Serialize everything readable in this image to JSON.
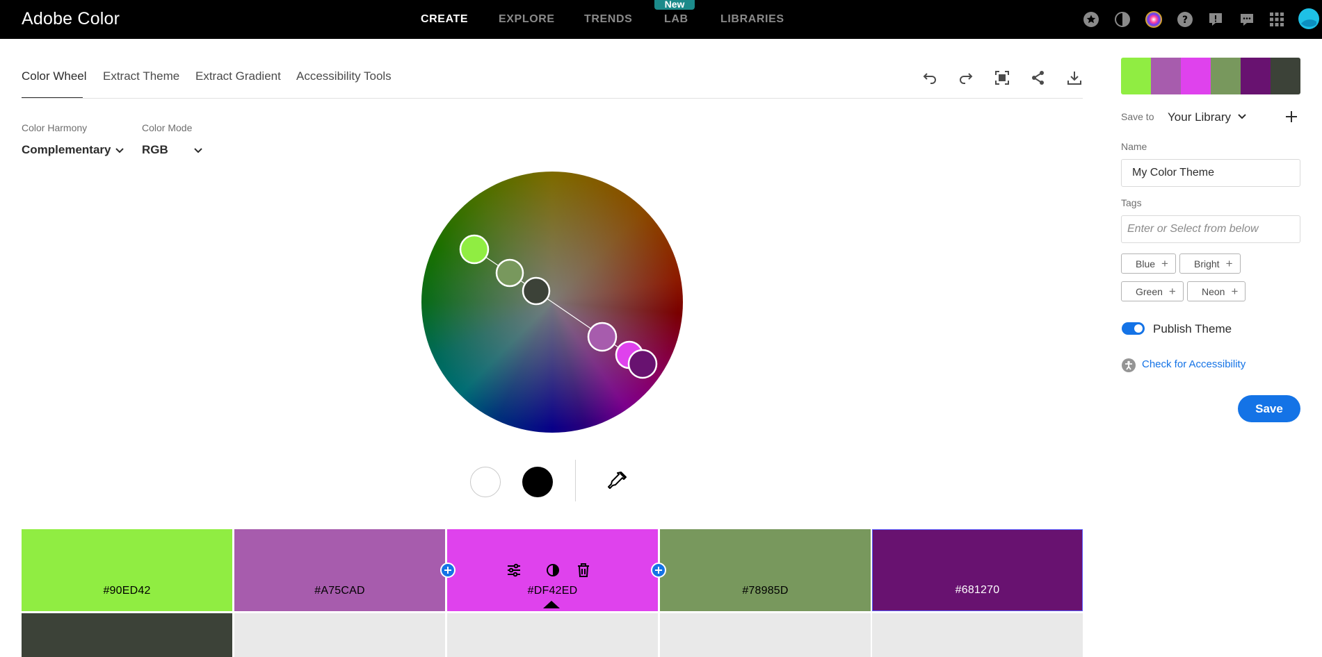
{
  "app": {
    "title": "Adobe Color"
  },
  "topnav": {
    "items": [
      {
        "label": "CREATE",
        "active": true
      },
      {
        "label": "EXPLORE",
        "active": false
      },
      {
        "label": "TRENDS",
        "active": false
      },
      {
        "label": "LAB",
        "active": false,
        "badge": "New"
      },
      {
        "label": "LIBRARIES",
        "active": false
      }
    ],
    "icons": [
      "star-icon",
      "contrast-icon",
      "color-wheel-icon",
      "help-icon",
      "feedback-icon",
      "chat-icon",
      "apps-grid-icon",
      "avatar"
    ]
  },
  "tabs": [
    {
      "label": "Color Wheel",
      "active": true
    },
    {
      "label": "Extract Theme",
      "active": false
    },
    {
      "label": "Extract Gradient",
      "active": false
    },
    {
      "label": "Accessibility Tools",
      "active": false
    }
  ],
  "toolbar": {
    "icons": [
      "undo-icon",
      "redo-icon",
      "fullscreen-icon",
      "share-icon",
      "download-icon"
    ]
  },
  "harmony": {
    "label": "Color Harmony",
    "value": "Complementary"
  },
  "mode": {
    "label": "Color Mode",
    "value": "RGB"
  },
  "swatches": [
    {
      "hex": "#90ED42",
      "color": "#90ED42",
      "text_color": "#000000"
    },
    {
      "hex": "#A75CAD",
      "color": "#A75CAD",
      "text_color": "#000000"
    },
    {
      "hex": "#DF42ED",
      "color": "#DF42ED",
      "text_color": "#000000",
      "selected": true
    },
    {
      "hex": "#78985D",
      "color": "#78985D",
      "text_color": "#000000"
    },
    {
      "hex": "#681270",
      "color": "#681270",
      "text_color": "#ffffff"
    }
  ],
  "extra_swatch": {
    "color": "#3C4238"
  },
  "palette_strip": [
    "#90ED42",
    "#A75CAD",
    "#DF42ED",
    "#78985D",
    "#681270",
    "#3C4238"
  ],
  "panel": {
    "save_to_label": "Save to",
    "library": "Your Library",
    "name_label": "Name",
    "name_value": "My Color Theme",
    "tags_label": "Tags",
    "tags_placeholder": "Enter or Select from below",
    "tags": [
      "Blue",
      "Bright",
      "Green",
      "Neon"
    ],
    "publish_label": "Publish Theme",
    "publish_on": true,
    "accessibility_link": "Check for Accessibility",
    "save_label": "Save"
  },
  "accent_color": "#1473e6"
}
